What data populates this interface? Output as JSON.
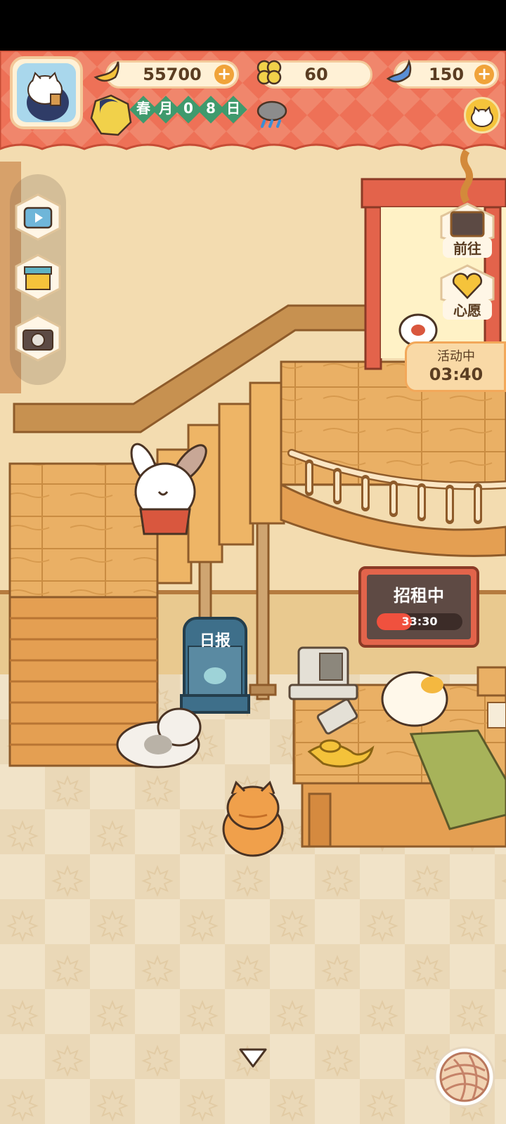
{
  "resources": {
    "banana": "55700",
    "clover": "60",
    "blue_banana": "150"
  },
  "date": {
    "season": "春",
    "month": "月",
    "day_digit1": "0",
    "day_digit2": "8",
    "day_suffix": "日"
  },
  "right_menu": {
    "go_label": "前往",
    "wish_label": "心愿",
    "event_status": "活动中",
    "event_timer": "03:40"
  },
  "rental_sign": {
    "title": "招租中",
    "timer": "33:30"
  },
  "daily_board": {
    "title": "日报"
  },
  "colors": {
    "hud_red": "#ee7157",
    "hud_cream": "#fff1d6",
    "wood": "#e8ad5a",
    "date_green": "#3f9a6d"
  }
}
